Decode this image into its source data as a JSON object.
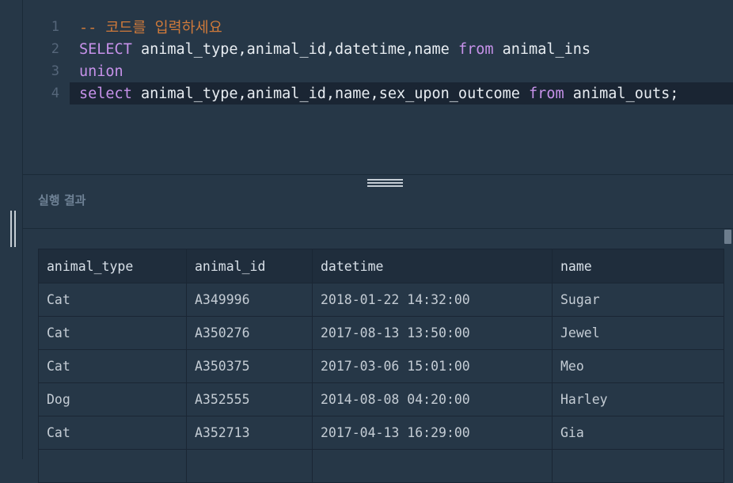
{
  "editor": {
    "lines": [
      {
        "num": "1",
        "segments": [
          {
            "t": "-- 코드를 입력하세요",
            "k": "cm"
          }
        ]
      },
      {
        "num": "2",
        "segments": [
          {
            "t": "SELECT",
            "k": "kw"
          },
          {
            "t": " animal_type,animal_id,datetime,name ",
            "k": "code"
          },
          {
            "t": "from",
            "k": "kw"
          },
          {
            "t": " animal_ins",
            "k": "code"
          }
        ]
      },
      {
        "num": "3",
        "segments": [
          {
            "t": "union",
            "k": "kw"
          }
        ]
      },
      {
        "num": "4",
        "segments": [
          {
            "t": "select",
            "k": "kw"
          },
          {
            "t": " animal_type,animal_id,name,sex_upon_outcome ",
            "k": "code"
          },
          {
            "t": "from",
            "k": "kw"
          },
          {
            "t": " animal_outs;",
            "k": "code"
          }
        ]
      }
    ],
    "active_line": 4
  },
  "result": {
    "title": "실행 결과",
    "columns": [
      "animal_type",
      "animal_id",
      "datetime",
      "name"
    ],
    "rows": [
      [
        "Cat",
        "A349996",
        "2018-01-22 14:32:00",
        "Sugar"
      ],
      [
        "Cat",
        "A350276",
        "2017-08-13 13:50:00",
        "Jewel"
      ],
      [
        "Cat",
        "A350375",
        "2017-03-06 15:01:00",
        "Meo"
      ],
      [
        "Dog",
        "A352555",
        "2014-08-08 04:20:00",
        "Harley"
      ],
      [
        "Cat",
        "A352713",
        "2017-04-13 16:29:00",
        "Gia"
      ],
      [
        "",
        "",
        "",
        ""
      ]
    ]
  },
  "colors": {
    "background": "#263747",
    "keyword": "#c792ea",
    "comment": "#d07a3a",
    "header_bg": "#1f2d3c"
  }
}
